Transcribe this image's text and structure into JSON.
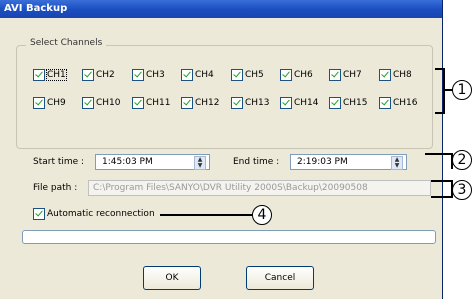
{
  "window": {
    "title": "AVI Backup"
  },
  "channels": {
    "legend": "Select Channels",
    "row1": [
      "CH1",
      "CH2",
      "CH3",
      "CH4",
      "CH5",
      "CH6",
      "CH7",
      "CH8"
    ],
    "row2": [
      "CH9",
      "CH10",
      "CH11",
      "CH12",
      "CH13",
      "CH14",
      "CH15",
      "CH16"
    ]
  },
  "time": {
    "start_label": "Start time :",
    "start_value": "1:45:03 PM",
    "end_label": "End time :",
    "end_value": "2:19:03 PM"
  },
  "path": {
    "label": "File path :",
    "value": "C:\\Program Files\\SANYO\\DVR Utility 2000S\\Backup\\20090508"
  },
  "reconnect": {
    "label": "Automatic reconnection"
  },
  "buttons": {
    "ok": "OK",
    "cancel": "Cancel"
  },
  "callouts": {
    "c1": "1",
    "c2": "2",
    "c3": "3",
    "c4": "4"
  }
}
